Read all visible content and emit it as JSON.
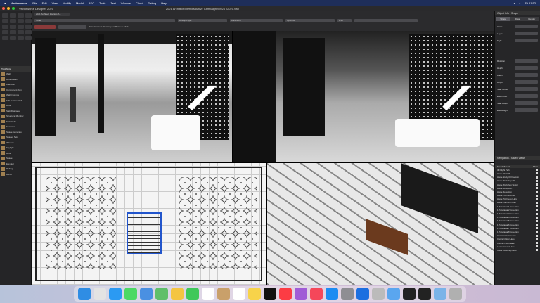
{
  "menubar": {
    "apple": "",
    "items": [
      "Vectorworks",
      "File",
      "Edit",
      "View",
      "Modify",
      "Model",
      "AEC",
      "Tools",
      "Text",
      "Window",
      "Cloud",
      "Debug",
      "Help"
    ],
    "clock": "Fri 11:52"
  },
  "window": {
    "app_title": "Vectorworks Designer 2021",
    "doc_title": "2021 Architect Interiors Active Campaign v2024 v2021.vwx",
    "doc_tab": "2021 Architect Interiors A..."
  },
  "toolbar": {
    "class": "None",
    "layer": "Design Layer",
    "view": "Wireframe",
    "render": "Open GL",
    "scale": "1:48",
    "message": "Selection tool: Rectangular Marquee Mode"
  },
  "tool_list": {
    "header": "Tool Sets",
    "items": [
      "Wall",
      "Round Wall",
      "Wall Join",
      "Component Join",
      "Wall Closings",
      "Edit Curtain Wall",
      "Door",
      "Slab Drainage",
      "Structural Member",
      "Stair Cube",
      "Escalator",
      "Space Generator",
      "Spaces Sets",
      "Window",
      "Skylight",
      "Roof",
      "Space",
      "Elevator",
      "Railing",
      "Ramp"
    ]
  },
  "object_info": {
    "title": "Object Info - Shape",
    "tabs": [
      "Shape",
      "Data",
      "Render"
    ],
    "active_tab": "Shape",
    "labels": [
      "Class",
      "Layer",
      "Style",
      "Rotation",
      "Height",
      "Width",
      "Depth",
      "Start Offset",
      "End Offset",
      "Start Height",
      "End Height"
    ]
  },
  "saved_views": {
    "title": "Navigation - Saved Views",
    "col_name": "Saved View Na...",
    "col_show": "Show",
    "items": [
      "3D Flight Path",
      "Home Shell 3D",
      "Home Study 3D Diagram",
      "Home Workshop 3D",
      "Home Workshop Sketch",
      "Home Reception 3",
      "Home Reception",
      "Home Pin Interior 3D",
      "Home Pin Interior Hero",
      "Home Full Hero Color",
      "1 Panorama 1 Collection",
      "1 Panorama 2 Collection",
      "1 Panorama 3 Collection",
      "1 Panorama 4 Collection",
      "1 Panorama 5 Collection",
      "1 Panorama 6 Collection",
      "1 Panorama 7 Collection",
      "1 Panorama 8 Collection",
      "Contract Sketch Hero",
      "Contract Floor Hero",
      "Contract Workplace",
      "Lower Ground Hero",
      "Office Workshop Hero"
    ]
  },
  "dock": {
    "apps": [
      "Finder",
      "Launchpad",
      "Safari",
      "Messages",
      "Mail",
      "Maps",
      "Photos",
      "FaceTime",
      "Calendar",
      "Contacts",
      "Reminders",
      "Notes",
      "TV",
      "Music",
      "Podcasts",
      "News",
      "App Store",
      "System Preferences",
      "Xcode",
      "Disk Utility",
      "Preview",
      "Terminal",
      "Vectorworks",
      "Downloads",
      "Trash"
    ],
    "colors": [
      "#2f8de4",
      "#e3e3e3",
      "#2b9af3",
      "#4cd964",
      "#4a90e2",
      "#5fbf6a",
      "#f4c542",
      "#3fc85a",
      "#ffffff",
      "#c9a06a",
      "#ffffff",
      "#f7d34a",
      "#111111",
      "#fc3c44",
      "#a05cd6",
      "#f5475a",
      "#1c8cf2",
      "#8e8e93",
      "#1c6fe0",
      "#bbbbbb",
      "#5aa6ef",
      "#222222",
      "#222222",
      "#7ab3e8",
      "#b0b0b0"
    ]
  }
}
